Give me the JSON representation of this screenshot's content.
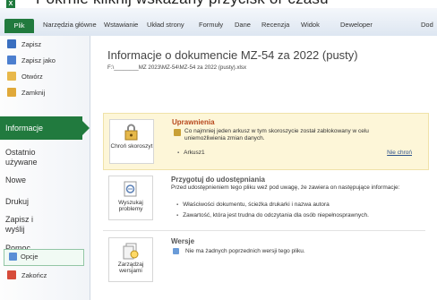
{
  "caption_text": "Pokrnie kliknij wskazany przycisk or czasu",
  "ribbon": {
    "file_tab": "Plik",
    "tabs": [
      "Narzędzia główne",
      "Wstawianie",
      "Układ strony",
      "Formuły",
      "Dane",
      "Recenzja",
      "Widok",
      "Deweloper",
      "Dod"
    ]
  },
  "sidebar": {
    "save": "Zapisz",
    "save_as": "Zapisz jako",
    "open": "Otwórz",
    "close": "Zamknij",
    "info": "Informacje",
    "recent": "Ostatnio używane",
    "new": "Nowe",
    "print": "Drukuj",
    "save_send": "Zapisz i wyślij",
    "help": "Pomoc",
    "options": "Opcje",
    "exit": "Zakończ"
  },
  "main": {
    "title": "Informacje o dokumencie MZ-54 za 2022 (pusty)",
    "path": "F:\\________MZ 2023\\MZ-54\\MZ-54 za 2022 (pusty).xlsx",
    "permissions": {
      "button_label": "Chroń skoroszyt",
      "heading": "Uprawnienia",
      "text": "Co najmniej jeden arkusz w tym skoroszycie został zablokowany w celu uniemożliwienia zmian danych.",
      "sheet": "Arkusz1",
      "unprotect_link": "Nie chroń"
    },
    "prepare": {
      "button_label": "Wyszukaj problemy",
      "heading": "Przygotuj do udostępniania",
      "text": "Przed udostępnieniem tego pliku weź pod uwagę, że zawiera on następujące informacje:",
      "items": [
        "Właściwości dokumentu, ścieżka drukarki i nazwa autora",
        "Zawartość, która jest trudna do odczytania dla osób niepełnosprawnych."
      ]
    },
    "versions": {
      "button_label": "Zarządzaj wersjami",
      "heading": "Wersje",
      "text": "Nie ma żadnych poprzednich wersji tego pliku."
    }
  },
  "colors": {
    "accent": "#217a3e",
    "link": "#2a4f8a"
  }
}
